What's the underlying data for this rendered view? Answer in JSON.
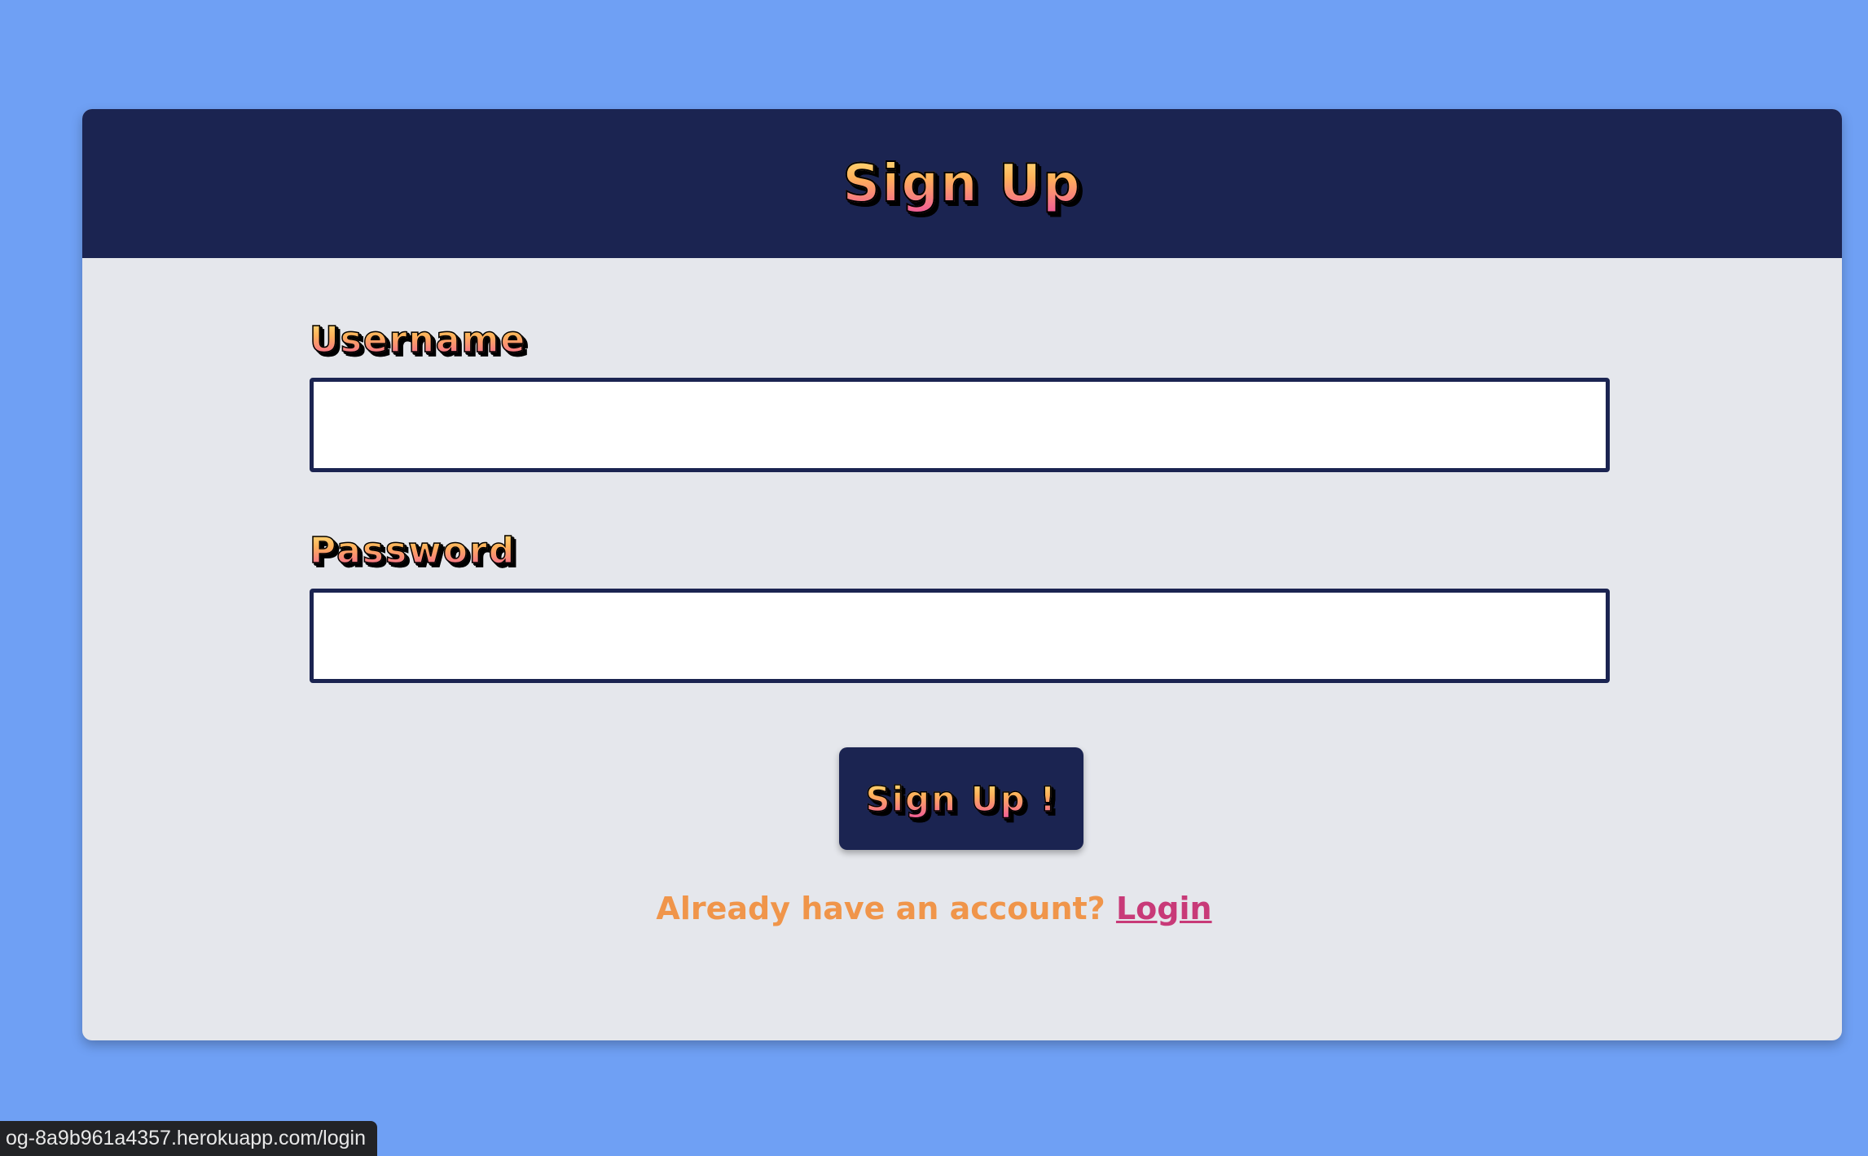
{
  "header": {
    "title": "Sign Up"
  },
  "form": {
    "username_label": "Username",
    "username_value": "",
    "password_label": "Password",
    "password_value": "",
    "submit_label": "Sign Up !"
  },
  "footer": {
    "account_prompt": "Already have an account?",
    "login_label": "Login"
  },
  "status_bar": {
    "url": "og-8a9b961a4357.herokuapp.com/login"
  },
  "colors": {
    "background": "#6fa0f4",
    "header_bg": "#1b2451",
    "card_bg": "#e5e7ec",
    "prompt_text": "#f0954a",
    "login_link": "#c83a78"
  }
}
